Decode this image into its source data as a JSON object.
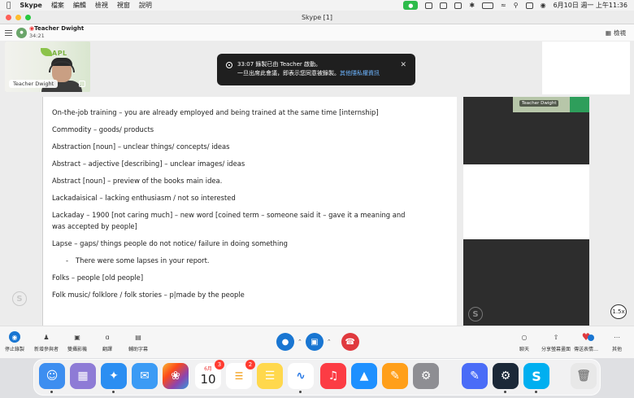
{
  "menubar": {
    "app_name": "Skype",
    "menus": [
      "檔案",
      "編輯",
      "檢視",
      "視窗",
      "說明"
    ],
    "datetime": "6月10日 週一 上午11:36"
  },
  "window": {
    "title": "Skype [1]"
  },
  "call": {
    "name": "Teacher Dwight",
    "duration": "34:21",
    "grid_label": "檢視"
  },
  "self_video": {
    "name": "Teacher Dwight",
    "logo_text": "APL"
  },
  "recording_notice": {
    "time": "33:07",
    "line1_text": "錄製已由 Teacher 啟動。",
    "line2_text": "一旦出席此會議，即表示您同意被錄製。",
    "link_text": "其他隱私權資訊"
  },
  "document": {
    "lines": [
      "On-the-job training – you are already employed and being trained at the same time [internship]",
      "Commodity – goods/ products",
      "Abstraction [noun] – unclear things/ concepts/ ideas",
      "Abstract – adjective [describing] – unclear images/ ideas",
      "Abstract [noun] – preview of the books main idea.",
      "Lackadaisical – lacking enthusiasm / not so interested",
      "Lackaday – 1900 [not caring much] – new word [coined term – someone said it – gave it a meaning and",
      "was accepted by people]",
      "Lapse – gaps/ things people do not notice/ failure in doing something",
      "Folks – people [old people]",
      "Folk music/ folklore / folk stories – p|made by the people"
    ],
    "bullet": {
      "marker": "-",
      "text": "There were some lapses in your report."
    }
  },
  "participant_mini": {
    "name": "Teacher Dwight"
  },
  "playback_speed": "1.5x",
  "toolbar": {
    "stop_recording": "停止錄製",
    "add_participant": "新增參與者",
    "dual_video": "雙攝影機",
    "translate": "翻譯",
    "captions": "輔助字幕",
    "chat": "聊天",
    "share_screen": "分享螢幕畫面",
    "send_reaction": "傳送表情…",
    "more": "其他"
  },
  "dock": {
    "calendar_month": "6月",
    "calendar_day": "10",
    "calendar_badge": "3",
    "reminders_badge": "2"
  }
}
